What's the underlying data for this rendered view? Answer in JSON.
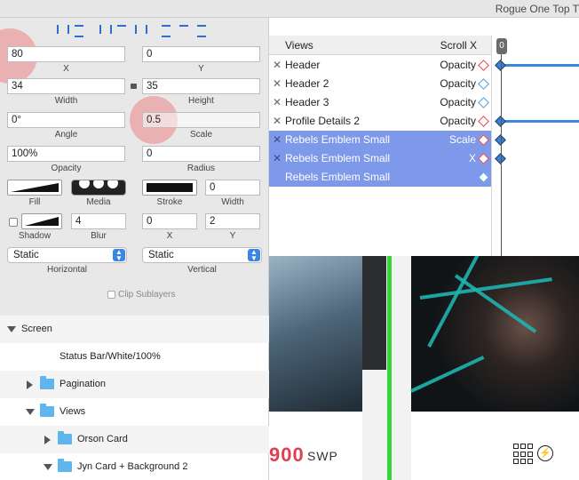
{
  "window": {
    "title": "Rogue One Top T"
  },
  "inspector": {
    "x": {
      "value": "80",
      "label": "X"
    },
    "y": {
      "value": "0",
      "label": "Y"
    },
    "width": {
      "value": "34",
      "label": "Width"
    },
    "height": {
      "value": "35",
      "label": "Height"
    },
    "angle": {
      "value": "0°",
      "label": "Angle"
    },
    "scale": {
      "value": "0.5",
      "label": "Scale"
    },
    "opacity": {
      "value": "100%",
      "label": "Opacity"
    },
    "radius": {
      "value": "0",
      "label": "Radius"
    },
    "fill_label": "Fill",
    "media_label": "Media",
    "stroke_label": "Stroke",
    "stroke_width": {
      "value": "0",
      "label": "Width"
    },
    "shadow_label": "Shadow",
    "blur": {
      "value": "4",
      "label": "Blur"
    },
    "shadow_x": {
      "value": "0",
      "label": "X"
    },
    "shadow_y": {
      "value": "2",
      "label": "Y"
    },
    "horizontal": {
      "value": "Static",
      "label": "Horizontal"
    },
    "vertical": {
      "value": "Static",
      "label": "Vertical"
    },
    "clip_sublayers": "Clip Sublayers",
    "highlight_color": "#ec6e6e"
  },
  "layers": [
    {
      "name": "Screen",
      "expanded": true
    },
    {
      "name": "Status Bar/White/100%"
    },
    {
      "name": "Pagination",
      "expanded": false
    },
    {
      "name": "Views",
      "expanded": true
    },
    {
      "name": "Orson Card",
      "expanded": false
    },
    {
      "name": "Jyn Card + Background 2",
      "expanded": true
    }
  ],
  "timeline": {
    "col_views": "Views",
    "col_scroll": "Scroll X",
    "playhead": "0",
    "rows": [
      {
        "name": "Header",
        "prop": "Opacity",
        "selected": false,
        "keyframe": true
      },
      {
        "name": "Header 2",
        "prop": "Opacity",
        "selected": false,
        "keyframe": false
      },
      {
        "name": "Header 3",
        "prop": "Opacity",
        "selected": false,
        "keyframe": false
      },
      {
        "name": "Profile Details 2",
        "prop": "Opacity",
        "selected": false,
        "keyframe": true
      },
      {
        "name": "Rebels Emblem Small",
        "prop": "Scale",
        "selected": true,
        "keyframe": true
      },
      {
        "name": "Rebels Emblem Small",
        "prop": "X",
        "selected": true,
        "keyframe": true
      },
      {
        "name": "Rebels Emblem Small",
        "prop": "",
        "selected": true,
        "keyframe": false
      }
    ],
    "accent": "#7e99e9"
  },
  "preview": {
    "price": "900",
    "price_unit": "SWP",
    "grid_icon": "grid-icon",
    "bolt_icon": "bolt-icon",
    "bolt_glyph": "⚡"
  }
}
